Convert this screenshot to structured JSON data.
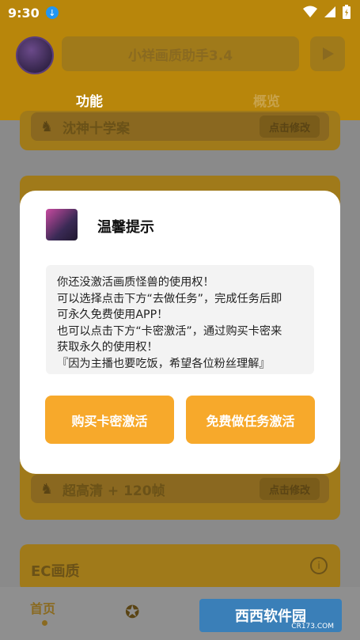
{
  "status_bar": {
    "time": "9:30"
  },
  "header": {
    "title": "小祥画质助手3.4",
    "tabs": [
      "功能",
      "概览"
    ]
  },
  "cards": {
    "top_row_label": "沈神十学案",
    "top_row_button": "点击修改",
    "fps_row_label": "超高清 + 120帧",
    "fps_row_button": "点击修改",
    "ec_title": "EC画质"
  },
  "bottom_nav": {
    "home": "首页"
  },
  "watermark": {
    "brand": "西西软件园",
    "site": "CR173.COM"
  },
  "dialog": {
    "title": "温馨提示",
    "message_lines": [
      "你还没激活画质怪兽的使用权！",
      "可以选择点击下方“去做任务”，完成任务后即",
      "可永久免费使用APP！",
      "也可以点击下方“卡密激活”，通过购买卡密来",
      "获取永久的使用权！",
      "『因为主播也要吃饭，希望各位粉丝理解』"
    ],
    "buy_button": "购买卡密激活",
    "task_button": "免费做任务激活"
  },
  "colors": {
    "accent": "#f7a92b",
    "appbar": "#b8860b"
  }
}
